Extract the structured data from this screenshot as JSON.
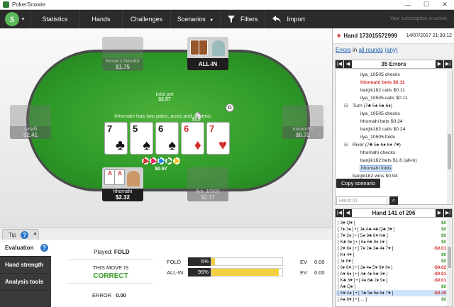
{
  "window": {
    "title": "PokerSnowie",
    "min": "—",
    "max": "☐",
    "close": "✕"
  },
  "menu": {
    "logo": "S",
    "items": [
      "Statistics",
      "Hands",
      "Challenges",
      "Scenarios"
    ],
    "filters": "Filters",
    "import": "Import",
    "subscription": "Your subscription is active."
  },
  "table": {
    "players": [
      {
        "name": "Kovacs Nandor",
        "stack": "$1.75"
      },
      {
        "name": "",
        "stack": "ALL-IN"
      },
      {
        "name": "natalli",
        "stack": "$2.41"
      },
      {
        "name": "miriam82",
        "stack": "$0.72"
      },
      {
        "name": "hhomahi",
        "stack": "$2.32"
      },
      {
        "name": "ilya_10505",
        "stack": "$2.17"
      }
    ],
    "total_pot_label": "total pot",
    "total_pot": "$2.57",
    "hand_description": "hhomahi has two pairs, aces and sevens.",
    "bet_amount": "$1.6",
    "pot": "$0.97",
    "dealer": "D",
    "board": [
      {
        "rank": "7",
        "suit": "♣",
        "color": "black"
      },
      {
        "rank": "5",
        "suit": "♠",
        "color": "black"
      },
      {
        "rank": "6",
        "suit": "♠",
        "color": "black"
      },
      {
        "rank": "6",
        "suit": "♦",
        "color": "red"
      },
      {
        "rank": "7",
        "suit": "♥",
        "color": "red"
      }
    ],
    "hero_cards": [
      "A",
      "A"
    ]
  },
  "tip": {
    "label": "Tip",
    "help": "?"
  },
  "bottom_nav": [
    "Evaluation",
    "Hand strength",
    "Analysis tools"
  ],
  "evaluation": {
    "played_label": "Played:",
    "played_value": "FOLD",
    "move_is": "THIS MOVE IS",
    "verdict": "CORRECT",
    "error_label": "ERROR",
    "error_value": "0.00",
    "actions": [
      {
        "name": "FOLD",
        "pct": "5%",
        "fraction": 0.05,
        "ev_label": "EV",
        "ev": "0.00"
      },
      {
        "name": "ALL-IN",
        "pct": "95%",
        "fraction": 0.95,
        "ev_label": "EV",
        "ev": "0.00"
      }
    ]
  },
  "hand_panel": {
    "hand_id": "Hand 173015572999",
    "date": "14/07/2017 21:30:12",
    "errors_link": "Errors",
    "in": "in",
    "all_rounds": "all rounds",
    "any": "(any)",
    "errors_count": "35 Errors",
    "tree": [
      "ilya_10505 checks",
      "hhomahi bets $0.11",
      "banjik182 calls $0.11",
      "ilya_10505 calls $0.11",
      "Turn (7♣ 5♠ 6♠ 6♦)",
      "ilya_10505 checks",
      "hhomahi bets $0.24",
      "banjik182 calls $0.24",
      "ilya_10505 folds",
      "River (7♣ 5♠ 6♠ 6♦ 7♥)",
      "hhomahi checks",
      "banjik182 bets $1.6 (all-in)",
      "hhomahi folds",
      "banjik182 wins $0.94"
    ],
    "copy_scenario": "Copy scenario",
    "hand_id_placeholder": "Hand ID",
    "list_title": "Hand 141 of 296",
    "hands": [
      {
        "cards": "[ 3♥ Q♥ ]",
        "value": "$0"
      },
      {
        "cards": "[ 7♦ 3♠ ] • [ J♠ A♣ 4♣ Q♣ 3♥ ]",
        "value": "$0"
      },
      {
        "cards": "[ 7♥ 2♦ ] • [ 5♠ 9♣ 8♥ K♣ ]",
        "value": "$0"
      },
      {
        "cards": "[ K♣ 4♦ ] • [ 6♠ 6♥ 8♦ 1♥ ]",
        "value": "$0"
      },
      {
        "cards": "[ 2♥ 8♦ ] • [ 7♦ 2♣ 3♣ 4♦ 7♥ ]",
        "value": "-$0.01"
      },
      {
        "cards": "[ K♦ 4♥ ]",
        "value": "$0"
      },
      {
        "cards": "[ J♦ 8♥ ]",
        "value": "$0"
      },
      {
        "cards": "[ 6♦ 6♥ ] • [ 3♠ 4♠ 5♥ 8♥ 9♦ ]",
        "value": "-$0.02"
      },
      {
        "cards": "[ A♥ 6♦ ] • [ 4♣ 4♦ 6♣ 3♥ ]",
        "value": "-$0.01"
      },
      {
        "cards": "[ K♣ 3♥ ] • [ 4♦ 6♣ 2♦ 9♦ ]",
        "value": "-$0.01"
      },
      {
        "cards": "[ A♣ Q♠ ]",
        "value": "$0"
      },
      {
        "cards": "[ A♥ A♦ ] • [ 7♣ 5♠ 6♠ 6♦ 7♥ ]",
        "value": "-$0.40"
      },
      {
        "cards": "[ A♠ 8♥ ] • [ ... ]",
        "value": "$0"
      }
    ]
  },
  "colors": {
    "felt": "#2e9a28",
    "dark": "#2b2b2b",
    "correct": "#3a9a2a",
    "error_red": "#d32f2f",
    "bar": "#f4d03f"
  }
}
